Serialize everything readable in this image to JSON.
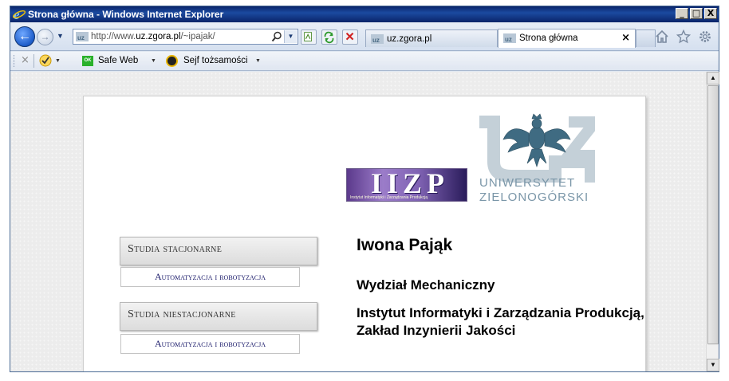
{
  "window": {
    "title": "Strona główna - Windows Internet Explorer",
    "minimize": "_",
    "maximize": "□",
    "close": "X"
  },
  "nav": {
    "back_glyph": "←",
    "forward_glyph": "→",
    "dropdown_glyph": "▼",
    "url_prefix": "http://www.",
    "url_domain": "uz.zgora.pl",
    "url_suffix": "/~ipajak/",
    "addr_drop_glyph": "▼"
  },
  "tabs": [
    {
      "label": "uz.zgora.pl",
      "active": false
    },
    {
      "label": "Strona główna",
      "active": true,
      "close": "×"
    }
  ],
  "favbar": {
    "close_glyph": "×",
    "drop_glyph": "▼",
    "safeweb_icon": "OK",
    "safeweb_label": "Safe Web",
    "sejf_label": "Sejf tożsamości"
  },
  "page": {
    "iizp_text": "IIZP",
    "iizp_sub": "Instytut Informatyki i Zarządzania Produkcją",
    "uz_name1": "UNIWERSYTET",
    "uz_name2": "ZIELONOGÓRSKI",
    "menu": [
      {
        "heading": "Studia stacjonarne",
        "item": "Automatyzacja i robotyzacja"
      },
      {
        "heading": "Studia niestacjonarne",
        "item": "Automatyzacja i robotyzacja"
      }
    ],
    "person_name": "Iwona Pająk",
    "faculty": "Wydział Mechaniczny",
    "institute": "Instytut Informatyki i Zarządzania Produkcją, Zakład Inzynierii Jakości"
  },
  "scrollbar": {
    "up_glyph": "▲",
    "down_glyph": "▼"
  }
}
